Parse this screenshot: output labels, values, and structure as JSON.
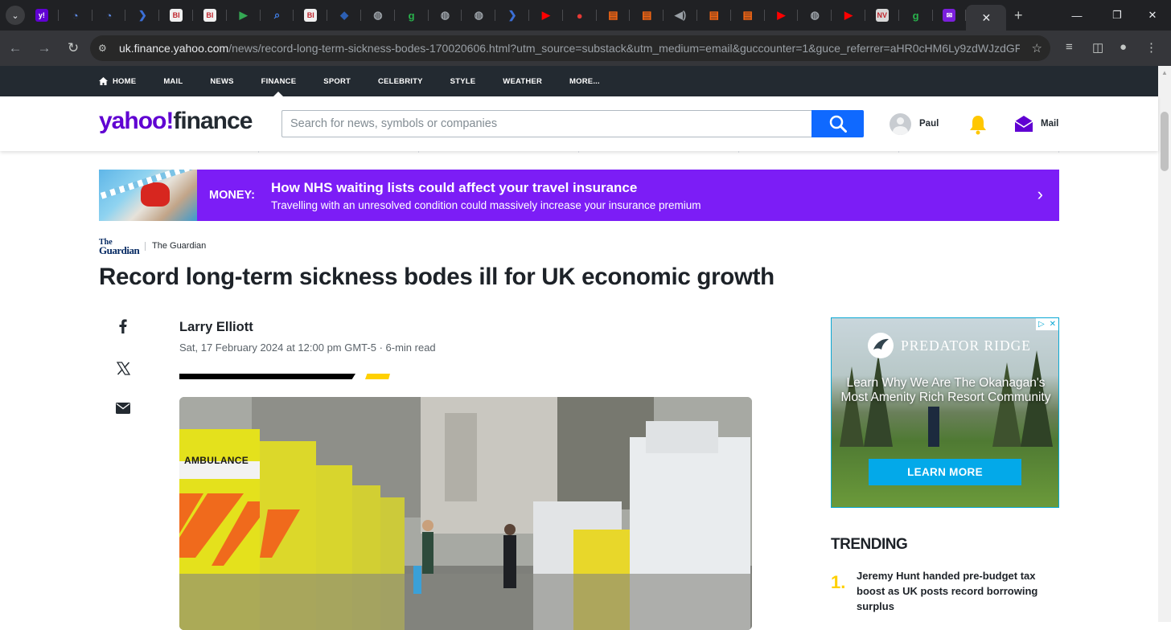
{
  "browser": {
    "url_host": "uk.finance.yahoo.com",
    "url_path": "/news/record-long-term-sickness-bodes-170020606.html?utm_source=substack&utm_medium=email&guccounter=1&guce_referrer=aHR0cHM6Ly9zdWJzdGFjay5jb20...",
    "tabs": [
      {
        "label": "y!",
        "color": "#6001d2"
      },
      {
        "label": "◔",
        "color": "#5f8de8"
      },
      {
        "label": "◔",
        "color": "#5f8de8"
      },
      {
        "label": "❯",
        "color": "#3b6fd6"
      },
      {
        "label": "BI",
        "color": "#f0f0f0"
      },
      {
        "label": "BI",
        "color": "#f0f0f0"
      },
      {
        "label": "▶",
        "color": "#34a853"
      },
      {
        "label": "⌕",
        "color": "#4285f4"
      },
      {
        "label": "BI",
        "color": "#f0f0f0"
      },
      {
        "label": "◆",
        "color": "#2c5fb3"
      },
      {
        "label": "◍",
        "color": "#9aa0a6"
      },
      {
        "label": "g",
        "color": "#29b24c"
      },
      {
        "label": "◍",
        "color": "#9aa0a6"
      },
      {
        "label": "◍",
        "color": "#9aa0a6"
      },
      {
        "label": "❯",
        "color": "#3b6fd6"
      },
      {
        "label": "▶",
        "color": "#ff0000"
      },
      {
        "label": "●",
        "color": "#e53935"
      },
      {
        "label": "▤",
        "color": "#ff6a13"
      },
      {
        "label": "▤",
        "color": "#ff6a13"
      },
      {
        "label": "◀)",
        "color": "#9aa0a6"
      },
      {
        "label": "▤",
        "color": "#ff6a13"
      },
      {
        "label": "▤",
        "color": "#ff6a13"
      },
      {
        "label": "▶",
        "color": "#ff0000"
      },
      {
        "label": "◍",
        "color": "#9aa0a6"
      },
      {
        "label": "▶",
        "color": "#ff0000"
      },
      {
        "label": "NV",
        "color": "#d8d8d8"
      },
      {
        "label": "g",
        "color": "#29b24c"
      },
      {
        "label": "✉",
        "color": "#7b1fdc"
      }
    ]
  },
  "yahoo_nav": {
    "items": [
      "HOME",
      "MAIL",
      "NEWS",
      "FINANCE",
      "SPORT",
      "CELEBRITY",
      "STYLE",
      "WEATHER",
      "MORE..."
    ],
    "active": "FINANCE"
  },
  "header": {
    "logo_yahoo": "yahoo!",
    "logo_finance": "finance",
    "search_placeholder": "Search for news, symbols or companies",
    "username": "Paul",
    "mail_label": "Mail"
  },
  "banner": {
    "tag": "MONEY:",
    "title": "How NHS waiting lists could affect your travel insurance",
    "subtitle": "Travelling with an unresolved condition could massively increase your insurance premium"
  },
  "article": {
    "source_logo_top": "The",
    "source_logo_bottom": "Guardian",
    "source": "The Guardian",
    "headline": "Record long-term sickness bodes ill for UK economic growth",
    "author": "Larry Elliott",
    "dateline": "Sat, 17 February 2024 at 12:00 pm GMT-5 · 6-min read",
    "photo_sign": "AMBULANCE"
  },
  "ad": {
    "brand": "PREDATOR RIDGE",
    "copy": "Learn Why We Are The Okanagan's Most Amenity Rich Resort Community",
    "cta": "LEARN MORE"
  },
  "trending": {
    "title": "TRENDING",
    "items": [
      {
        "rank": "1.",
        "text": "Jeremy Hunt handed pre-budget tax boost as UK posts record borrowing surplus"
      }
    ]
  },
  "colors": {
    "yahoo_purple": "#6001d2",
    "banner_purple": "#7c1df6",
    "search_blue": "#0f69ff",
    "trending_yellow": "#ffd000"
  }
}
